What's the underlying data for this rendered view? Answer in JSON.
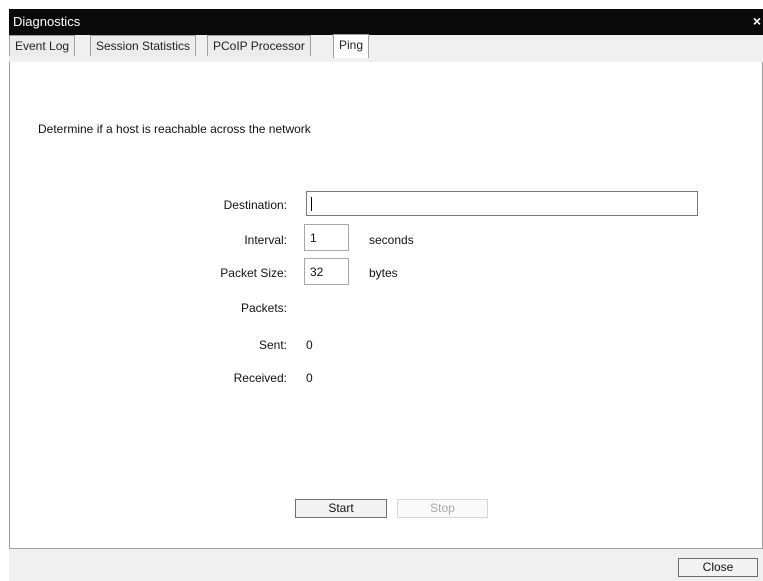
{
  "window": {
    "title": "Diagnostics",
    "close_glyph": "×"
  },
  "tabs": [
    {
      "label": "Event Log",
      "active": false
    },
    {
      "label": "Session Statistics",
      "active": false
    },
    {
      "label": "PCoIP Processor",
      "active": false
    },
    {
      "label": "Ping",
      "active": true
    }
  ],
  "ping": {
    "description": "Determine if a host is reachable across the network",
    "destination_label": "Destination:",
    "destination_value": "",
    "interval_label": "Interval:",
    "interval_value": "1",
    "interval_unit": "seconds",
    "packet_size_label": "Packet Size:",
    "packet_size_value": "32",
    "packet_size_unit": "bytes",
    "packets_label": "Packets:",
    "sent_label": "Sent:",
    "sent_value": "0",
    "received_label": "Received:",
    "received_value": "0",
    "start_label": "Start",
    "stop_label": "Stop"
  },
  "footer": {
    "close_label": "Close"
  }
}
